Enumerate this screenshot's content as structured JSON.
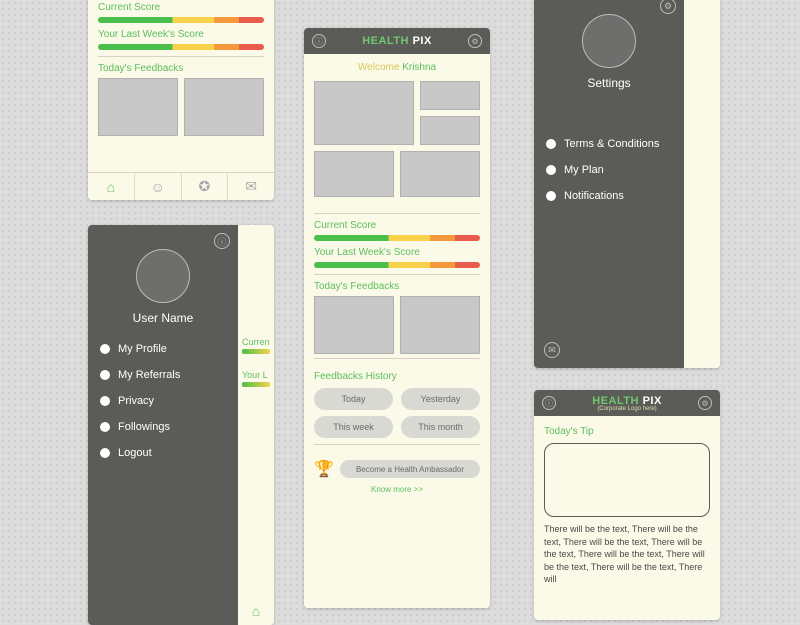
{
  "logo": {
    "health": "HEALTH",
    "pix": "PIX",
    "corp_sub": "(Corporate Logo here)"
  },
  "screenA": {
    "current_score": "Current Score",
    "last_week": "Your Last Week's Score",
    "feedbacks": "Today's Feedbacks"
  },
  "screenB": {
    "title": "User Name",
    "items": [
      "My Profile",
      "My Referrals",
      "Privacy",
      "Followings",
      "Logout"
    ],
    "behind_current": "Current",
    "behind_last": "Your L"
  },
  "screenC": {
    "welcome_label": "Welcome",
    "welcome_name": "Krishna",
    "current_score": "Current Score",
    "last_week": "Your Last Week's Score",
    "feedbacks": "Today's Feedbacks",
    "history": "Feedbacks History",
    "pills": [
      "Today",
      "Yesterday",
      "This week",
      "This month"
    ],
    "ambassador": "Become a Health Ambassador",
    "know_more": "Know more >>"
  },
  "screenD": {
    "title": "Settings",
    "items": [
      "Terms & Conditions",
      "My Plan",
      "Notifications"
    ]
  },
  "screenE": {
    "tip_label": "Today's Tip",
    "tip_text": "There will be the text, There will be the text, There will be the text, There will be the text, There will be the text, There will be the text, There will be the text, There will"
  }
}
